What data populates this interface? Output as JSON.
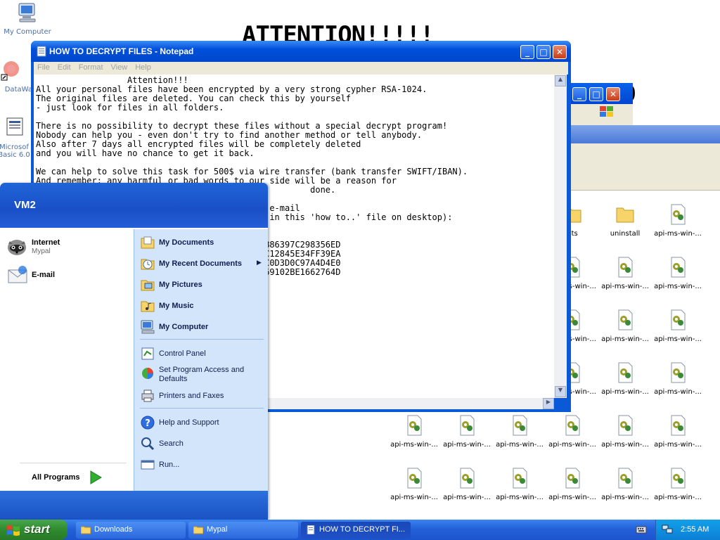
{
  "desktop": {
    "icons": [
      {
        "label": "My Computer"
      },
      {
        "label": "DataWa"
      },
      {
        "label": "Microsof Basic 6.0"
      }
    ],
    "wallpaper_title": "ATTENTION!!!!!",
    "wallpaper_fragment": "D"
  },
  "notepad": {
    "title": "HOW TO DECRYPT FILES - Notepad",
    "menu": [
      "File",
      "Edit",
      "Format",
      "View",
      "Help"
    ],
    "text": "                  Attention!!!\nAll your personal files have been encrypted by a very strong cypher RSA-1024.\nThe original files are deleted. You can check this by yourself\n- just look for files in all folders.\n\nThere is no possibility to decrypt these files without a special decrypt program!\nNobody can help you - even don't try to find another method or tell anybody.\nAlso after 7 days all encrypted files will be completely deleted\nand you will have no chance to get it back.\n\nWe can help to solve this task for 500$ via wire transfer (bank transfer SWIFT/IBAN).\nAnd remember: any harmful or bad words to our side will be a reason for\n                                                      done.\n\n                                      on this e-mail\n                                      n below in this 'how to..' file on desktop):\n\n\n                                     3FB9C401B86397C298356ED\n                                     C330A1FCC12845E34FF39EA\n                                     CBD8C1B9C0D3D0C97A4D4E0\n                                     EAD6F38A69102BE1662764D"
  },
  "explorer": {
    "files": [
      "nts",
      "uninstall",
      "api-ms-win-...",
      "api-",
      "api-ms-win-...",
      "api-ms-win-...",
      "api-ms-win-...",
      "api-",
      "api-ms-win-...",
      "api-ms-win-...",
      "api-ms-win-...",
      "api-",
      "api-ms-win-...",
      "api-ms-win-...",
      "api-ms-win-...",
      "api-",
      "api-ms-win-...",
      "api-ms-win-...",
      "api-ms-win-...",
      "api-ms-win-...",
      "api-ms-win-...",
      "api-ms-win-...",
      "api-",
      "api-ms-win-...",
      "api-ms-win-...",
      "api-ms-win-...",
      "api-ms-win-...",
      "api-ms-win-...",
      "api-ms-win-...",
      "api-"
    ]
  },
  "start_menu": {
    "username": "VM2",
    "pinned": [
      {
        "label": "Internet",
        "sub": "Mypal"
      },
      {
        "label": "E-mail",
        "sub": ""
      }
    ],
    "all_programs": "All Programs",
    "right": [
      {
        "label": "My Documents",
        "bold": true
      },
      {
        "label": "My Recent Documents",
        "bold": true
      },
      {
        "label": "My Pictures",
        "bold": true
      },
      {
        "label": "My Music",
        "bold": true
      },
      {
        "label": "My Computer",
        "bold": true
      },
      {
        "label": "Control Panel",
        "bold": false
      },
      {
        "label": "Set Program Access and Defaults",
        "bold": false
      },
      {
        "label": "Printers and Faxes",
        "bold": false
      },
      {
        "label": "Help and Support",
        "bold": false
      },
      {
        "label": "Search",
        "bold": false
      },
      {
        "label": "Run...",
        "bold": false
      }
    ]
  },
  "taskbar": {
    "start_label": "start",
    "buttons": [
      {
        "label": "Downloads"
      },
      {
        "label": "Mypal"
      },
      {
        "label": "HOW TO DECRYPT FI..."
      }
    ],
    "clock": "2:55 AM"
  },
  "colors": {
    "xp_blue": "#0a5ad8",
    "start_green": "#2f8b2f",
    "start_menu_right": "#d3e5fa"
  }
}
